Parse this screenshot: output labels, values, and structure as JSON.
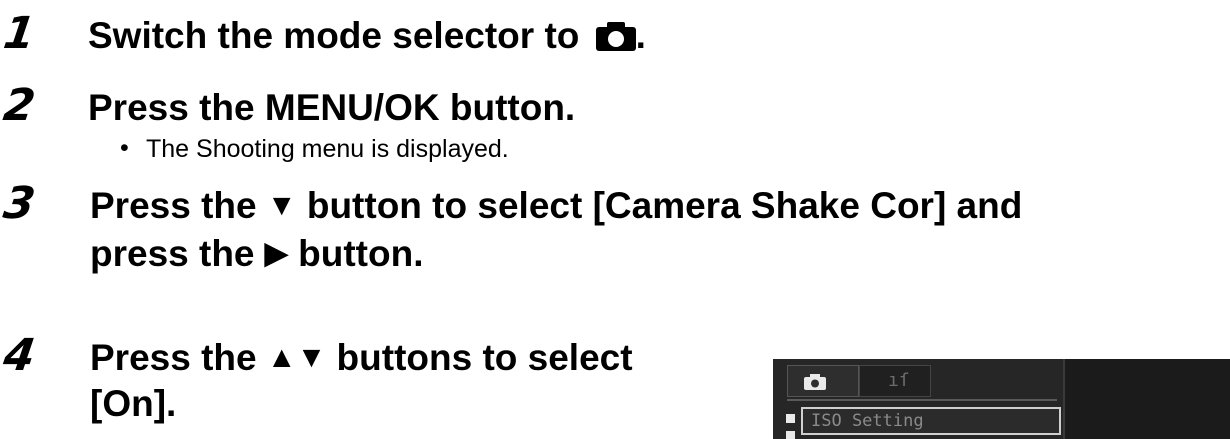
{
  "steps": [
    {
      "number": "1",
      "text": "Switch the mode selector to ",
      "icon": "camera-icon",
      "after": "."
    },
    {
      "number": "2",
      "text": "Press the MENU/OK button."
    },
    {
      "number": "3",
      "line1_pre": "Press the ",
      "line1_post": " button to select [Camera Shake Cor] and",
      "line2_pre": "press the ",
      "line2_post": " button."
    },
    {
      "number": "4",
      "line1_pre": "Press the ",
      "line1_post": " buttons to select",
      "line2": "[On]."
    }
  ],
  "bullet": {
    "dot": "•",
    "text": "The Shooting menu is displayed."
  },
  "glyphs": {
    "down": "▼",
    "right": "▶",
    "updown": "▲▼"
  },
  "lcd": {
    "tab2_icon": "wrench-icon",
    "menu_item": "ISO Setting"
  }
}
